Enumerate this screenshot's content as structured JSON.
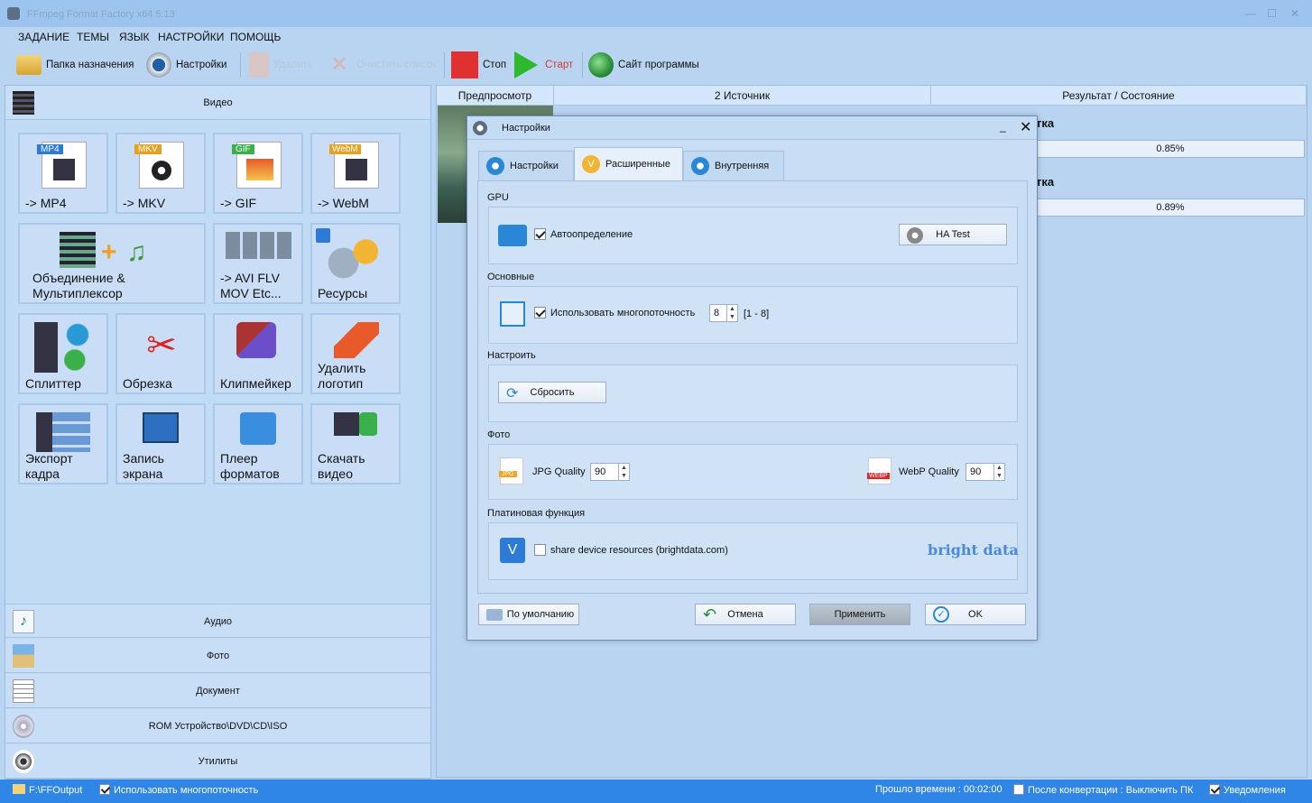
{
  "window": {
    "title": "FFmpeg Format Factory x64 5.13"
  },
  "menu": [
    "ЗАДАНИЕ",
    "ТЕМЫ",
    "ЯЗЫК",
    "НАСТРОЙКИ",
    "ПОМОЩЬ"
  ],
  "toolbar": {
    "dest_folder": "Папка назначения",
    "settings": "Настройки",
    "delete": "Удалить",
    "clear_list": "Очистить список",
    "stop": "Стоп",
    "start": "Старт",
    "website": "Сайт программы"
  },
  "left": {
    "video_cat": "Видео",
    "tiles": {
      "mp4": "-> MP4",
      "mkv": "-> MKV",
      "gif": "-> GIF",
      "webm": "-> WebM",
      "merge": "Объединение &\nМультиплексор",
      "avi": "-> AVI FLV\nMOV Etc...",
      "resources": "Ресурсы",
      "splitter": "Сплиттер",
      "crop": "Обрезка",
      "clipmaker": "Клипмейкер",
      "remove_logo": "Удалить\nлоготип",
      "export_frame": "Экспорт\nкадра",
      "screen_rec": "Запись\nэкрана",
      "player": "Плеер\nформатов",
      "download": "Скачать\nвидео"
    },
    "badges": {
      "mp4": "MP4",
      "mkv": "MKV",
      "gif": "GIF",
      "webm": "WebM"
    },
    "categories": [
      "Аудио",
      "Фото",
      "Документ",
      "ROM Устройство\\DVD\\CD\\ISO",
      "Утилиты"
    ]
  },
  "right": {
    "col_preview": "Предпросмотр",
    "col_source": "2 Источник",
    "col_result": "Результат / Состояние",
    "rows": [
      {
        "status": "тка",
        "progress": "0.85%"
      },
      {
        "status": "тка",
        "progress": "0.89%"
      }
    ]
  },
  "dialog": {
    "title": "Настройки",
    "tabs": [
      "Настройки",
      "Расширенные",
      "Внутренняя"
    ],
    "active_tab": 1,
    "gpu": {
      "section": "GPU",
      "autodetect": "Автоопределение",
      "autodetect_checked": true,
      "ha_test": "HA Test"
    },
    "basic": {
      "section": "Основные",
      "multithread": "Использовать многопоточность",
      "multithread_checked": true,
      "threads": "8",
      "range": "[1 - 8]"
    },
    "tune": {
      "section": "Настроить",
      "reset": "Сбросить"
    },
    "photo": {
      "section": "Фото",
      "jpg_label": "JPG Quality",
      "jpg_value": "90",
      "jpg_badge": "JPG",
      "webp_label": "WebP Quality",
      "webp_value": "90",
      "webp_badge": "WEBP"
    },
    "platinum": {
      "section": "Платиновая функция",
      "share": "share device resources (brightdata.com)",
      "share_checked": false,
      "brand": "bright data"
    },
    "buttons": {
      "defaults": "По умолчанию",
      "cancel": "Отмена",
      "apply": "Применить",
      "ok": "OK"
    }
  },
  "status": {
    "folder": "F:\\FFOutput",
    "multithread": "Использовать многопоточность",
    "elapsed": "Прошло времени : 00:02:00",
    "after": "После конвертации : Выключить ПК",
    "notify": "Уведомления"
  },
  "colors": {
    "accent": "#2f86e6",
    "stop": "#e03030",
    "start": "#2db82d",
    "brand": "#4a8ad8"
  }
}
